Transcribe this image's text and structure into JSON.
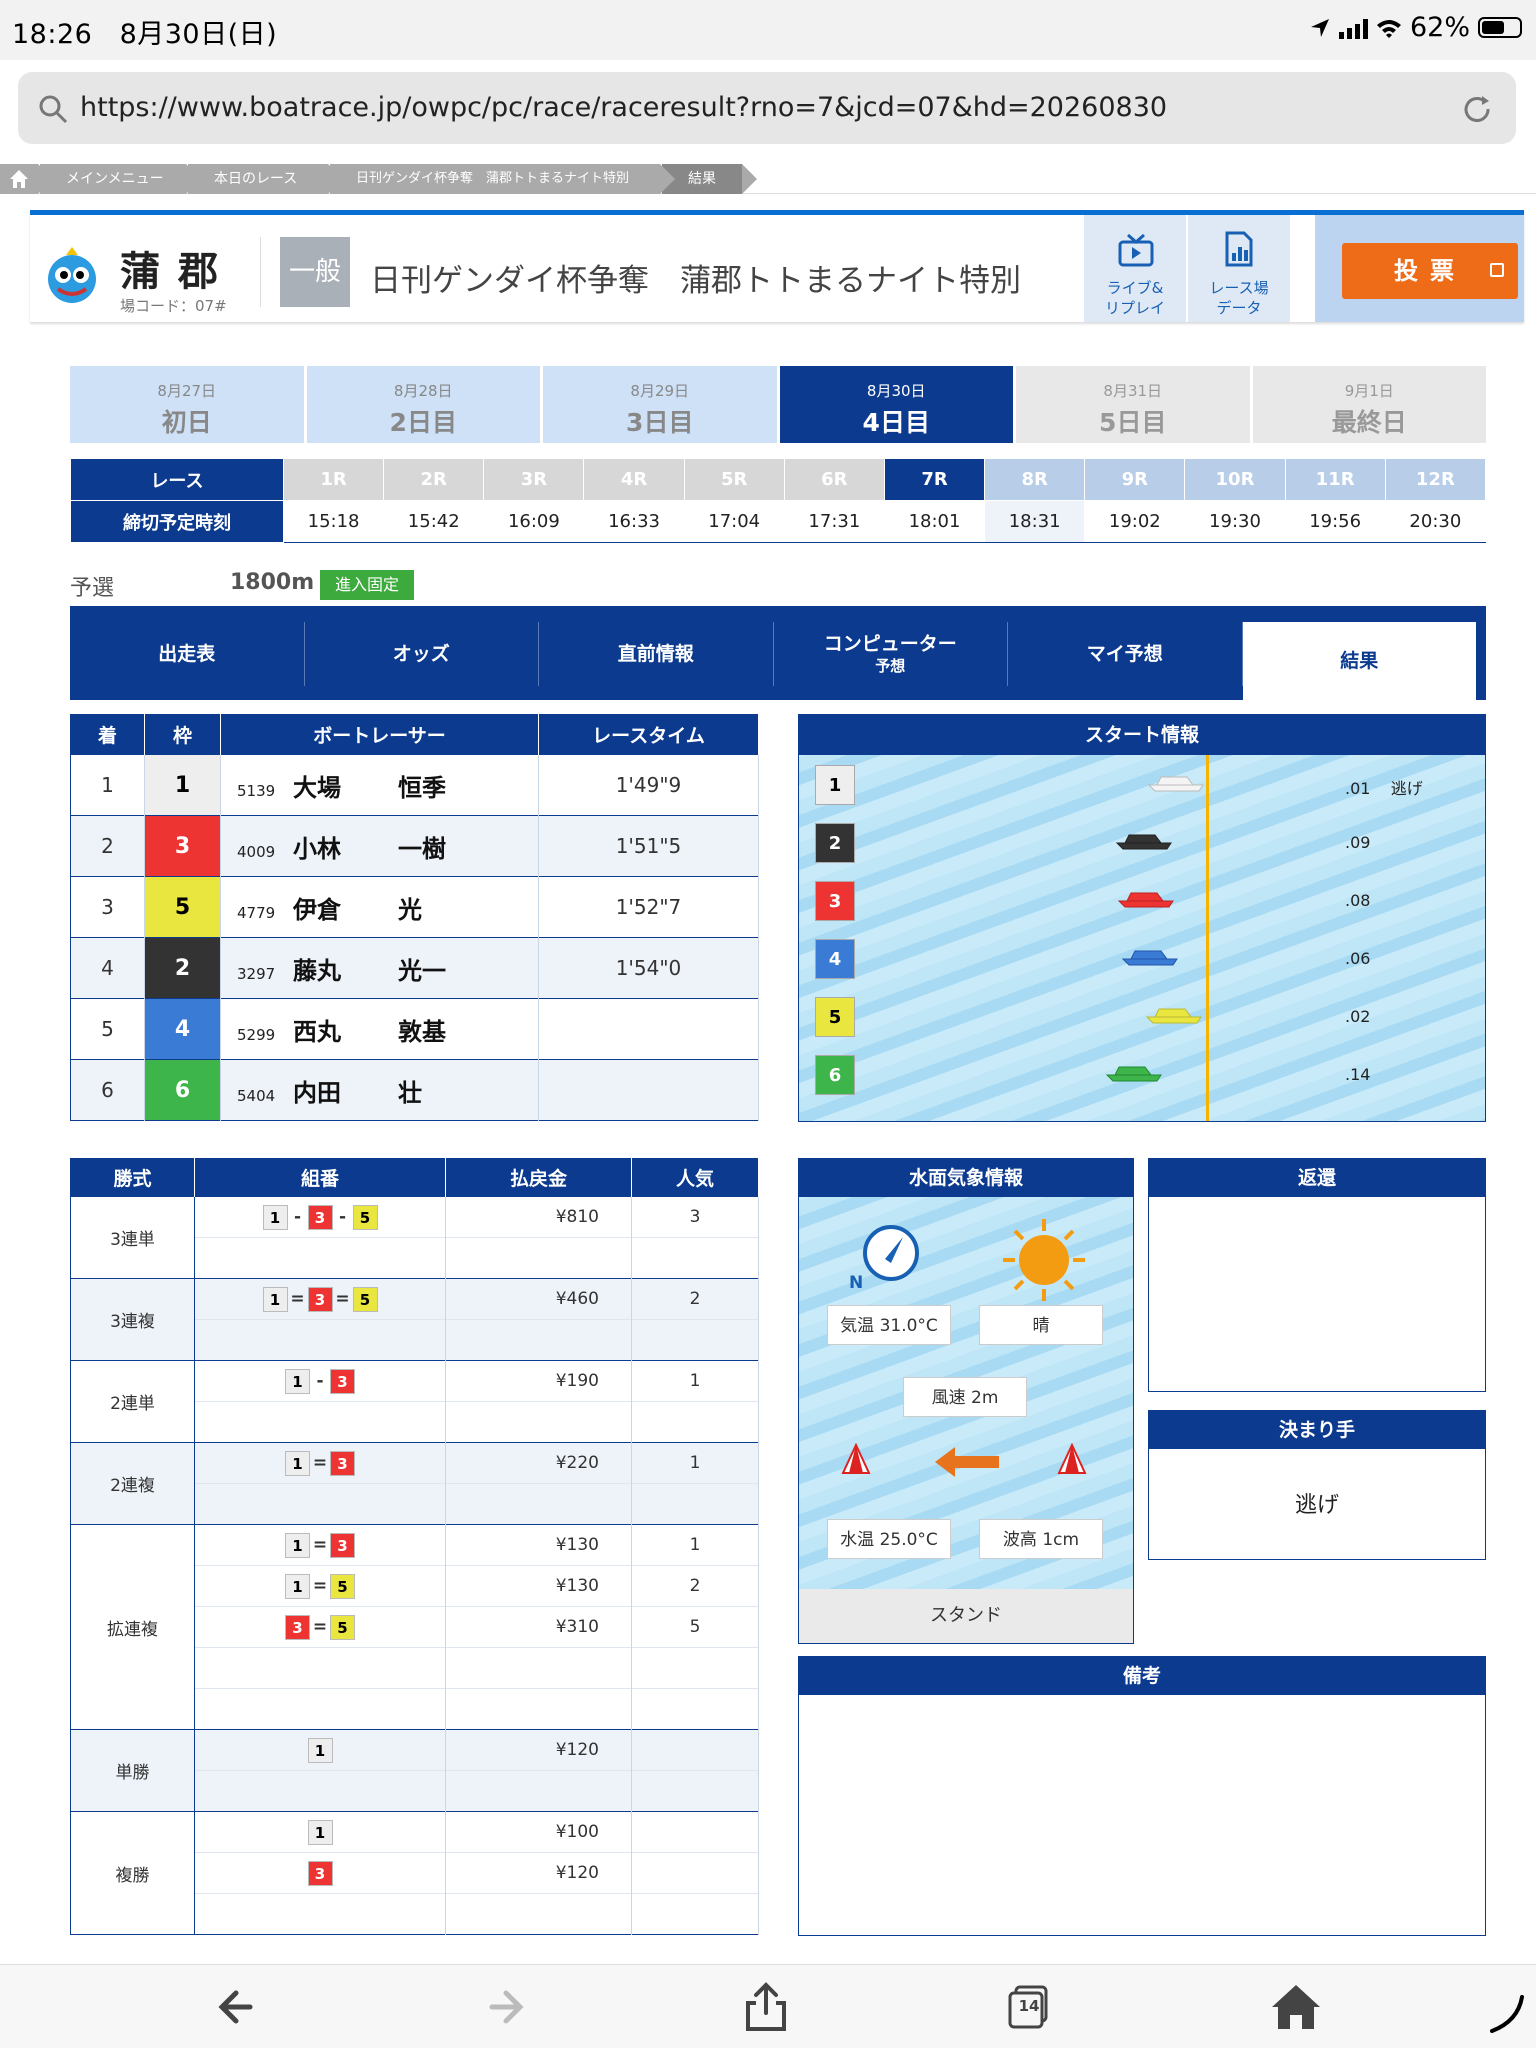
{
  "status_bar": {
    "time": "18:26",
    "date": "8月30日(日)",
    "battery": "62%"
  },
  "address_bar": {
    "url": "https://www.boatrace.jp/owpc/pc/race/raceresult?rno=7&jcd=07&hd=20260830"
  },
  "breadcrumbs": [
    "メインメニュー",
    "本日のレース",
    "日刊ゲンダイ杯争奪　蒲郡トトまるナイト特別",
    "結果"
  ],
  "header": {
    "stadium": "蒲郡",
    "stadium_code": "場コード：07#",
    "grade": "一般",
    "race_title": "日刊ゲンダイ杯争奪　蒲郡トトまるナイト特別",
    "live_label_1": "ライブ&",
    "live_label_2": "リプレイ",
    "data_label_1": "レース場",
    "data_label_2": "データ",
    "vote_label": "投票"
  },
  "days": [
    {
      "date": "8月27日",
      "name": "初日"
    },
    {
      "date": "8月28日",
      "name": "2日目"
    },
    {
      "date": "8月29日",
      "name": "3日目"
    },
    {
      "date": "8月30日",
      "name": "4日目"
    },
    {
      "date": "8月31日",
      "name": "5日目"
    },
    {
      "date": "9月1日",
      "name": "最終日"
    }
  ],
  "race_schedule": {
    "race_header": "レース",
    "time_header": "締切予定時刻",
    "races": [
      "1R",
      "2R",
      "3R",
      "4R",
      "5R",
      "6R",
      "7R",
      "8R",
      "9R",
      "10R",
      "11R",
      "12R"
    ],
    "times": [
      "15:18",
      "15:42",
      "16:09",
      "16:33",
      "17:04",
      "17:31",
      "18:01",
      "18:31",
      "19:02",
      "19:30",
      "19:56",
      "20:30"
    ]
  },
  "race_info": {
    "type": "予選",
    "distance": "1800m",
    "entry_fixed": "進入固定"
  },
  "tabs": {
    "t1": "出走表",
    "t2": "オッズ",
    "t3": "直前情報",
    "t4a": "コンピューター",
    "t4b": "予想",
    "t5": "マイ予想",
    "t6": "結果"
  },
  "results": {
    "headers": {
      "rank": "着",
      "frame": "枠",
      "racer": "ボートレーサー",
      "time": "レースタイム"
    },
    "rows": [
      {
        "rank": "1",
        "frame": "1",
        "reg": "5139",
        "last": "大場",
        "first": "恒季",
        "time": "1'49\"9"
      },
      {
        "rank": "2",
        "frame": "3",
        "reg": "4009",
        "last": "小林",
        "first": "一樹",
        "time": "1'51\"5"
      },
      {
        "rank": "3",
        "frame": "5",
        "reg": "4779",
        "last": "伊倉",
        "first": "光",
        "time": "1'52\"7"
      },
      {
        "rank": "4",
        "frame": "2",
        "reg": "3297",
        "last": "藤丸",
        "first": "光一",
        "time": "1'54\"0"
      },
      {
        "rank": "5",
        "frame": "4",
        "reg": "5299",
        "last": "西丸",
        "first": "敦基",
        "time": ""
      },
      {
        "rank": "6",
        "frame": "6",
        "reg": "5404",
        "last": "内田",
        "first": "壮",
        "time": ""
      }
    ]
  },
  "start_info": {
    "title": "スタート情報",
    "rows": [
      {
        "no": "1",
        "st": ".01",
        "note": "逃げ"
      },
      {
        "no": "2",
        "st": ".09",
        "note": ""
      },
      {
        "no": "3",
        "st": ".08",
        "note": ""
      },
      {
        "no": "4",
        "st": ".06",
        "note": ""
      },
      {
        "no": "5",
        "st": ".02",
        "note": ""
      },
      {
        "no": "6",
        "st": ".14",
        "note": ""
      }
    ]
  },
  "payouts": {
    "headers": {
      "kind": "勝式",
      "combo": "組番",
      "amount": "払戻金",
      "pop": "人気"
    },
    "k1": "3連単",
    "k2": "3連複",
    "k3": "2連単",
    "k4": "2連複",
    "k5": "拡連複",
    "k6": "単勝",
    "k7": "複勝",
    "v1": {
      "amount": "¥810",
      "pop": "3"
    },
    "v2": {
      "amount": "¥460",
      "pop": "2"
    },
    "v3": {
      "amount": "¥190",
      "pop": "1"
    },
    "v4": {
      "amount": "¥220",
      "pop": "1"
    },
    "v5a": {
      "amount": "¥130",
      "pop": "1"
    },
    "v5b": {
      "amount": "¥130",
      "pop": "2"
    },
    "v5c": {
      "amount": "¥310",
      "pop": "5"
    },
    "v6": {
      "amount": "¥120"
    },
    "v7a": {
      "amount": "¥100"
    },
    "v7b": {
      "amount": "¥120"
    }
  },
  "weather": {
    "title": "水面気象情報",
    "compass": "N",
    "temp": "気温 31.0°C",
    "condition": "晴",
    "wind": "風速 2m",
    "water_temp": "水温 25.0°C",
    "wave": "波高 1cm",
    "stand": "スタンド"
  },
  "refund": {
    "title": "返還"
  },
  "winning_move": {
    "title": "決まり手",
    "value": "逃げ"
  },
  "remarks": {
    "title": "備考"
  },
  "toolbar": {
    "tabs_count": "14"
  },
  "colors": {
    "navy": "#0b3a8f",
    "accent": "#ee6b18",
    "frame1": "#eeeeee",
    "frame2": "#333333",
    "frame3": "#e33333",
    "frame4": "#3a7bd5",
    "frame5": "#e9e640",
    "frame6": "#3db54a"
  }
}
